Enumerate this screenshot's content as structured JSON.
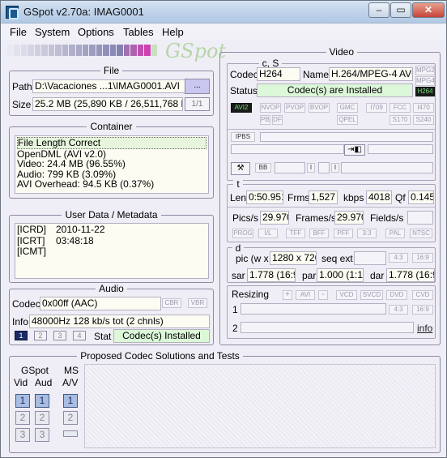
{
  "window": {
    "title": "GSpot v2.70a: IMAG0001"
  },
  "menu": [
    "File",
    "System",
    "Options",
    "Tables",
    "Help"
  ],
  "logo_text": "GSpot",
  "strip_colors": [
    "#e9e9f1",
    "#e2e2ec",
    "#dcdce8",
    "#d5d5e4",
    "#cfcfe0",
    "#c9c9dc",
    "#c3c3d8",
    "#bdbdd4",
    "#b6b6d0",
    "#b0b0cc",
    "#aaaac8",
    "#a3a3c4",
    "#9d9dc0",
    "#9696bc",
    "#9090b8",
    "#8a8ab4",
    "#8383b0",
    "#a070b0",
    "#b060b0",
    "#c050b0",
    "#d040b0",
    "#c7e1c0"
  ],
  "file": {
    "legend": "File",
    "path_label": "Path",
    "path_value": "D:\\Vacaciones ...1\\IMAG0001.AVI",
    "browse_label": "...",
    "size_label": "Size",
    "size_value": "25.2 MB (25,890 KB / 26,511,768 b",
    "page_value": "1/1"
  },
  "container": {
    "legend": "Container",
    "lines": [
      "File Length Correct",
      "OpenDML (AVI v2.0)",
      "Video: 24.4 MB (96.55%)",
      "Audio: 799 KB (3.09%)",
      "AVI Overhead: 94.5 KB (0.37%)"
    ]
  },
  "metadata": {
    "legend": "User Data / Metadata",
    "rows": [
      {
        "key": "[ICRD]",
        "value": "2010-11-22"
      },
      {
        "key": "[ICRT]",
        "value": "03:48:18"
      },
      {
        "key": "[ICMT]",
        "value": ""
      }
    ]
  },
  "audio": {
    "legend": "Audio",
    "codec_label": "Codec",
    "codec_value": "0x00ff (AAC)",
    "cbr": "CBR",
    "vbr": "VBR",
    "info_label": "Info",
    "info_value": "48000Hz  128 kb/s tot (2 chnls)",
    "streams": [
      "1",
      "2",
      "3",
      "4"
    ],
    "stat_label": "Stat",
    "stat_value": "Codec(s) Installed"
  },
  "video": {
    "legend": "Video",
    "cs_legend": "c, S",
    "codec_label": "Codec",
    "codec_value": "H264",
    "name_label": "Name",
    "name_value": "H.264/MPEG-4 AVC",
    "status_label": "Status",
    "status_value": "Codec(s) are Installed",
    "flags_right": [
      "MPG2",
      "MPG4",
      "H264"
    ],
    "flags_row1": [
      "AVI2",
      "NVOP",
      "PVOP",
      "BVOP",
      "GMC",
      "I709",
      "FCC",
      "I470"
    ],
    "flags_row2": [
      "PB",
      "DF",
      "QPEL",
      "S170",
      "S240"
    ],
    "ipbs": "IPBS",
    "bb": "BB",
    "t_legend": "t",
    "len_label": "Len",
    "len_value": "0:50.951",
    "frms_label": "Frms",
    "frms_value": "1,527",
    "kbps_label": "kbps",
    "kbps_value": "4018",
    "qf_label": "Qf",
    "qf_value": "0.145",
    "pics_label": "Pics/s",
    "pics_value": "29.970",
    "frames_label": "Frames/s",
    "frames_value": "29.970",
    "fields_label": "Fields/s",
    "t_flags": [
      "PROG",
      "I/L",
      "TFF",
      "BFF",
      "PFF",
      "3:3",
      "PAL",
      "NTSC"
    ],
    "d_legend": "d",
    "pic_label": "pic (w x",
    "pic_value": "1280 x 720",
    "seq_label": "seq ext",
    "ar43": "4:3",
    "ar169": "16:9",
    "sar_label": "sar",
    "sar_value": "1.778 (16:9)",
    "par_label": "par",
    "par_value": "1.000 (1:1)",
    "dar_label": "dar",
    "dar_value": "1.778 (16:9)",
    "resizing_label": "Resizing",
    "resize_buttons": [
      "+",
      "AVI",
      "-",
      "VCD",
      "SVCD",
      "DVD",
      "CVD"
    ],
    "row1_label": "1",
    "row2_label": "2",
    "info_link": "info"
  },
  "proposed": {
    "legend": "Proposed Codec Solutions and Tests",
    "gspot_label": "GSpot",
    "vid_label": "Vid",
    "aud_label": "Aud",
    "ms_label": "MS",
    "av_label": "A/V",
    "nums": [
      "1",
      "2",
      "3"
    ]
  }
}
